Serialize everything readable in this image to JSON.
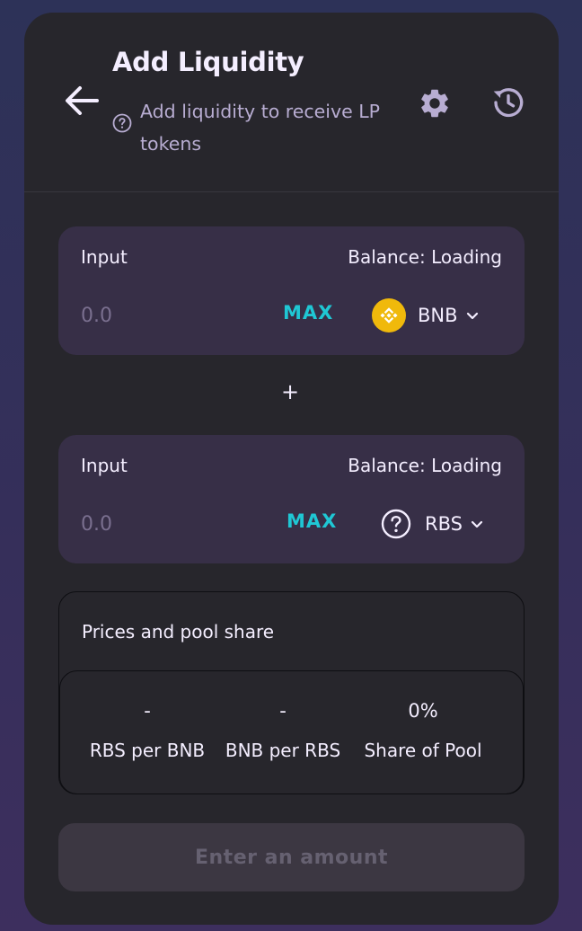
{
  "header": {
    "title": "Add Liquidity",
    "subtitle": "Add liquidity to receive LP tokens",
    "icons": {
      "back": "arrow-left-icon",
      "help": "question-circle-icon",
      "settings": "gear-icon",
      "history": "history-icon"
    }
  },
  "inputs": [
    {
      "label": "Input",
      "balance": "Balance: Loading",
      "placeholder": "0.0",
      "max_label": "MAX",
      "token": {
        "symbol": "BNB",
        "icon": "bnb-token-icon",
        "color": "#f0b90b"
      }
    },
    {
      "label": "Input",
      "balance": "Balance: Loading",
      "placeholder": "0.0",
      "max_label": "MAX",
      "token": {
        "symbol": "RBS",
        "icon": "question-circle-icon"
      }
    }
  ],
  "plus": "+",
  "prices": {
    "title": "Prices and pool share",
    "stats": [
      {
        "value": "-",
        "label": "RBS per BNB"
      },
      {
        "value": "-",
        "label": "BNB per RBS"
      },
      {
        "value": "0%",
        "label": "Share of Pool"
      }
    ]
  },
  "action": {
    "label": "Enter an amount",
    "disabled": true
  },
  "colors": {
    "card": "#27262c",
    "panel": "#372f47",
    "accent": "#1fc7d4",
    "text": "#f4eeff",
    "subtext": "#b8add2"
  }
}
